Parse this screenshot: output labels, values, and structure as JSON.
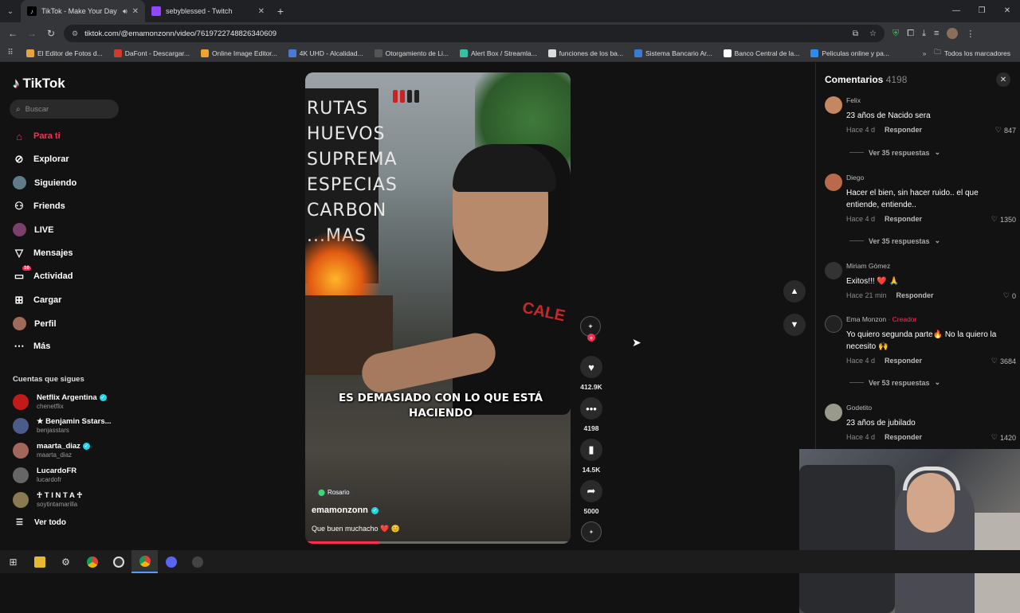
{
  "browser": {
    "tabs": [
      {
        "title": "TikTok - Make Your Day",
        "active": true
      },
      {
        "title": "sebyblessed - Twitch",
        "active": false
      }
    ],
    "url": "tiktok.com/@emamonzonn/video/7619722748826340609",
    "bookmarks": [
      {
        "label": "El Editor de Fotos d...",
        "color": "#e8a33a"
      },
      {
        "label": "DaFont - Descargar...",
        "color": "#d23a2a"
      },
      {
        "label": "Online Image Editor...",
        "color": "#f0a22a"
      },
      {
        "label": "4K UHD - Alcalidad...",
        "color": "#4a7bd4"
      },
      {
        "label": "Otorgamiento de Li...",
        "color": "#555555"
      },
      {
        "label": "Alert Box / Streamla...",
        "color": "#31c3a2"
      },
      {
        "label": "funciones de los ba...",
        "color": "#dddddd"
      },
      {
        "label": "Sistema Bancario Ar...",
        "color": "#3a7bd5"
      },
      {
        "label": "Banco Central de la...",
        "color": "#ffffff"
      },
      {
        "label": "Peliculas online y pa...",
        "color": "#2d8cf0"
      }
    ],
    "all_bookmarks": "Todos los marcadores"
  },
  "sidebar": {
    "logo": "TikTok",
    "search_placeholder": "Buscar",
    "nav": [
      {
        "label": "Para ti",
        "icon": "home-icon",
        "active": true
      },
      {
        "label": "Explorar",
        "icon": "compass-icon"
      },
      {
        "label": "Siguiendo",
        "icon": "following-icon"
      },
      {
        "label": "Friends",
        "icon": "friends-icon"
      },
      {
        "label": "LIVE",
        "icon": "live-icon"
      },
      {
        "label": "Mensajes",
        "icon": "messages-icon"
      },
      {
        "label": "Actividad",
        "icon": "activity-icon",
        "badge": "10"
      },
      {
        "label": "Cargar",
        "icon": "upload-icon"
      },
      {
        "label": "Perfil",
        "icon": "profile-icon"
      },
      {
        "label": "Más",
        "icon": "more-icon"
      }
    ],
    "following_title": "Cuentas que sigues",
    "following": [
      {
        "name": "Netflix Argentina",
        "handle": "chenetflix",
        "verified": true,
        "color": "#c11a1a"
      },
      {
        "name": "★ Benjamin Sstars...",
        "handle": "benjasstars",
        "verified": false,
        "color": "#4b5b8a"
      },
      {
        "name": "maarta_diaz",
        "handle": "maarta_diaz",
        "verified": true,
        "color": "#a2675a"
      },
      {
        "name": "LucardoFR",
        "handle": "lucardofr",
        "verified": false,
        "color": "#666666"
      },
      {
        "name": "♰ T I N T A ♰",
        "handle": "soytintamarilla",
        "verified": false,
        "color": "#8a7a50"
      }
    ],
    "see_all": "Ver todo"
  },
  "video": {
    "caption": "ES DEMASIADO CON LO QUE ESTÁ HACIENDO",
    "sign_text": "RUTAS\nHUEVOS\nSUPREMA\nESPECIAS\nCARBON\n...MAS",
    "shirt_text": "CALE",
    "location": "Rosario",
    "username": "emamonzonn",
    "description": "Que buen muchacho ❤️ 😊",
    "progress": 0.28
  },
  "actions": {
    "likes": "412.9K",
    "comments": "4198",
    "saves": "14.5K",
    "shares": "5000"
  },
  "comments_panel": {
    "title": "Comentarios",
    "count": "4198",
    "items": [
      {
        "user": "Felix",
        "text": "23 años de Nacido sera",
        "time": "Hace 4 d",
        "reply": "Responder",
        "likes": "847",
        "more": "Ver 35 respuestas",
        "color": "#c4875f"
      },
      {
        "user": "Diego",
        "text": "Hacer el bien, sin hacer ruido.. el que entiende, entiende..",
        "time": "Hace 4 d",
        "reply": "Responder",
        "likes": "1350",
        "more": "Ver 35 respuestas",
        "color": "#b86a4a"
      },
      {
        "user": "Miriam Gómez",
        "text": "Exitos!!! ❤️ 🙏",
        "time": "Hace 21 min",
        "reply": "Responder",
        "likes": "0",
        "more": "",
        "color": "#333333"
      },
      {
        "user": "Ema Monzon",
        "creator_tag": "· Creador",
        "text": "Yo quiero segunda parte🔥 No la quiero la necesito 🙌",
        "time": "Hace 4 d",
        "reply": "Responder",
        "likes": "3684",
        "more": "Ver 53 respuestas",
        "color": "#222222"
      },
      {
        "user": "Godetito",
        "text": "23 años de jubilado",
        "time": "Hace 4 d",
        "reply": "Responder",
        "likes": "1420",
        "more": "",
        "color": "#9a9a8a"
      }
    ]
  }
}
